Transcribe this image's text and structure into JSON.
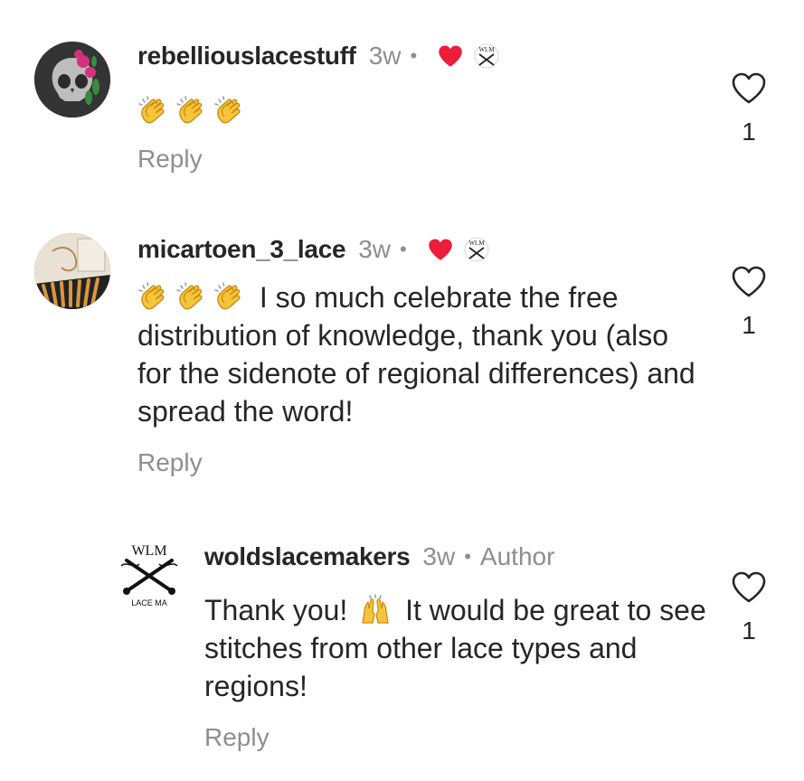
{
  "comments": [
    {
      "username": "rebelliouslacestuff",
      "time": "3w",
      "separator": "•",
      "text": "",
      "emoji_count": 3,
      "reply_label": "Reply",
      "like_count": "1",
      "liked_by_creator": true
    },
    {
      "username": "micartoen_3_lace",
      "time": "3w",
      "separator": "•",
      "text": "I so much celebrate the free distribution of knowledge, thank you (also for the sidenote of regional differences) and spread the word!",
      "emoji_count": 3,
      "reply_label": "Reply",
      "like_count": "1",
      "liked_by_creator": true
    },
    {
      "username": "woldslacemakers",
      "time": "3w",
      "separator": "•",
      "author_label": "Author",
      "text_before": "Thank you!",
      "text_after": "It would be great to see stitches from other lace types and regions!",
      "reply_label": "Reply",
      "like_count": "1"
    }
  ],
  "logo": {
    "top": "WLM",
    "bottom": "LACE MA"
  },
  "colors": {
    "heart": "#ed1c3a",
    "muted": "#8e8e8e",
    "text": "#262626"
  },
  "icons": [
    "heart-outline-icon",
    "red-heart-icon",
    "clapping-hands-emoji",
    "raising-hands-emoji",
    "wlm-logo-icon"
  ]
}
